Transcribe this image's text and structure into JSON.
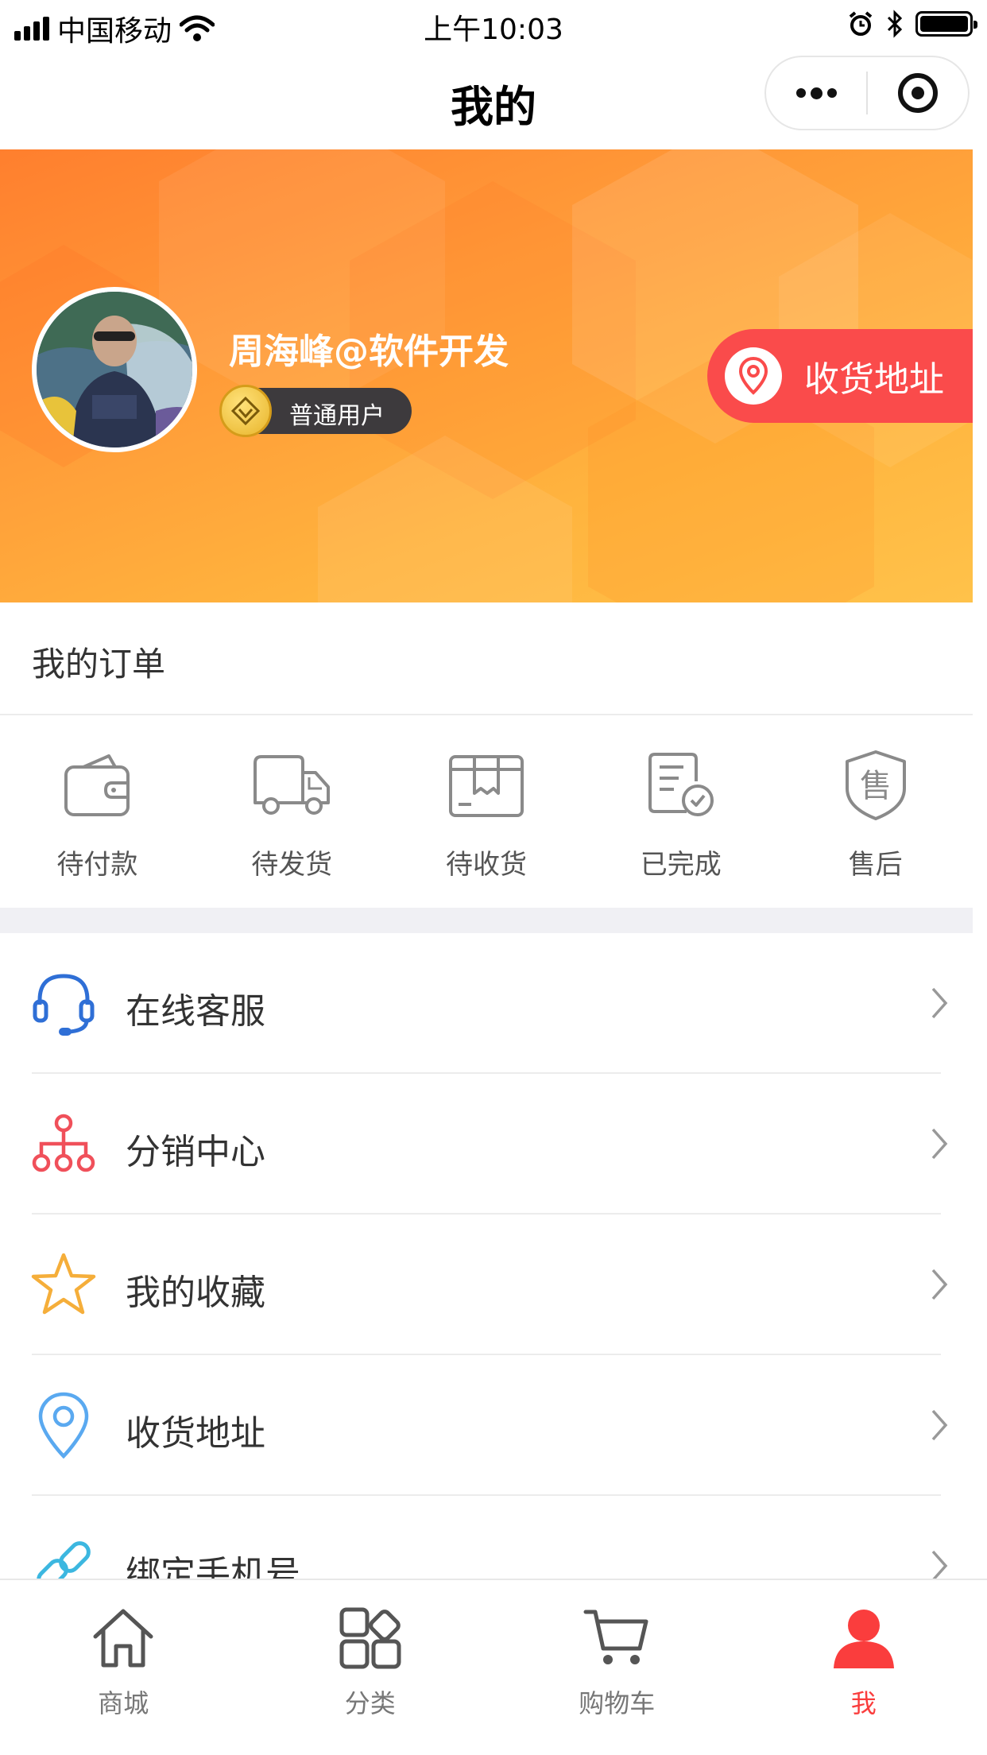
{
  "status_bar": {
    "carrier": "中国移动",
    "time": "上午10:03"
  },
  "nav": {
    "title": "我的"
  },
  "profile": {
    "name": "周海峰@软件开发",
    "level": "普通用户",
    "address_button": "收货地址"
  },
  "orders": {
    "title": "我的订单",
    "items": [
      {
        "label": "待付款",
        "icon": "wallet-icon"
      },
      {
        "label": "待发货",
        "icon": "truck-icon"
      },
      {
        "label": "待收货",
        "icon": "package-icon"
      },
      {
        "label": "已完成",
        "icon": "completed-doc-icon"
      },
      {
        "label": "售后",
        "icon": "shield-icon"
      }
    ]
  },
  "menu": [
    {
      "label": "在线客服",
      "icon": "headset-icon",
      "color": "#2f6fd6"
    },
    {
      "label": "分销中心",
      "icon": "network-icon",
      "color": "#f0505a"
    },
    {
      "label": "我的收藏",
      "icon": "star-icon",
      "color": "#f5ae3a"
    },
    {
      "label": "收货地址",
      "icon": "location-pin-icon",
      "color": "#5aa9f0"
    },
    {
      "label": "绑定手机号",
      "icon": "link-icon",
      "color": "#3cb7e0"
    }
  ],
  "tabs": [
    {
      "label": "商城",
      "icon": "home-icon",
      "active": false
    },
    {
      "label": "分类",
      "icon": "category-icon",
      "active": false
    },
    {
      "label": "购物车",
      "icon": "cart-icon",
      "active": false
    },
    {
      "label": "我",
      "icon": "user-icon",
      "active": true
    }
  ],
  "colors": {
    "accent": "#fa3d3d",
    "hero_start": "#ff7f2e",
    "hero_end": "#ffc24a",
    "address_button": "#fa4b4b"
  }
}
